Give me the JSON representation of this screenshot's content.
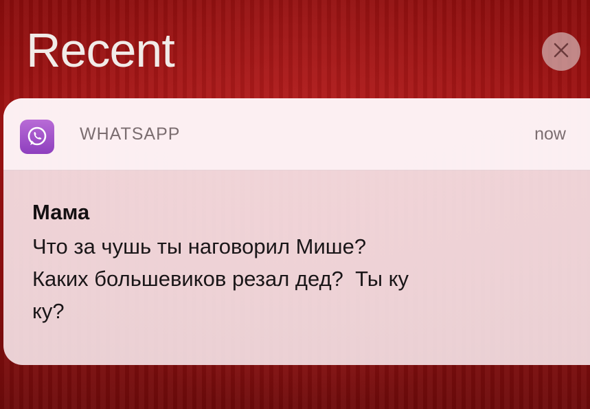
{
  "header": {
    "title": "Recent"
  },
  "close_button": {
    "icon": "close-icon"
  },
  "notification": {
    "app_icon": "whatsapp-icon",
    "app_name": "WHATSAPP",
    "time": "now",
    "sender": "Мама",
    "message": "Что за чушь ты наговорил Мише?\nКаких большевиков резал дед?  Ты ку\nку?"
  },
  "colors": {
    "background": "#a31414",
    "app_icon": "#9b4cc8",
    "card": "#f4e0e4"
  }
}
